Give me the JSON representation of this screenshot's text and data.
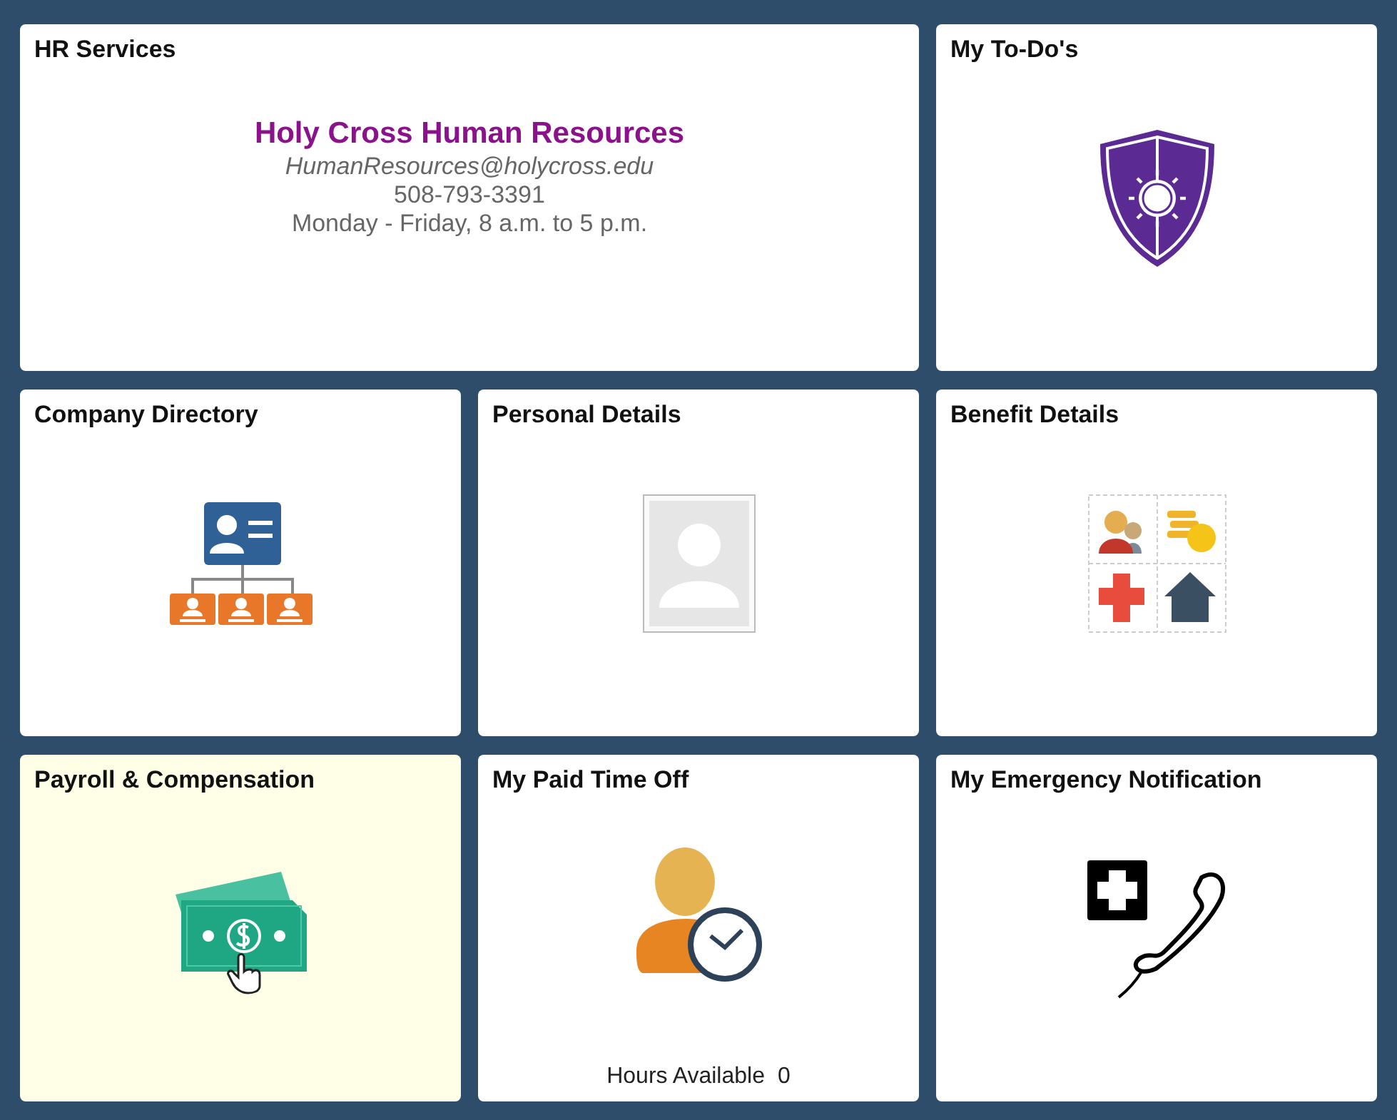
{
  "tiles": [
    {
      "title": "HR Services",
      "kind": "contact",
      "highlighted": false,
      "contact": {
        "name": "Holy Cross Human Resources",
        "email": "HumanResources@holycross.edu",
        "phone": "508-793-3391",
        "hours": "Monday - Friday, 8 a.m. to 5 p.m."
      }
    },
    {
      "title": "My To-Do's",
      "kind": "shield",
      "highlighted": false
    },
    {
      "title": "Company Directory",
      "kind": "orgchart",
      "highlighted": false
    },
    {
      "title": "Personal Details",
      "kind": "photo",
      "highlighted": false
    },
    {
      "title": "Benefit Details",
      "kind": "benefits",
      "highlighted": false
    },
    {
      "title": "Payroll & Compensation",
      "kind": "money",
      "highlighted": true
    },
    {
      "title": "My Paid Time Off",
      "kind": "timeoff",
      "highlighted": false,
      "footer": {
        "label": "Hours Available",
        "value": "0"
      }
    },
    {
      "title": "My Emergency Notification",
      "kind": "emergency",
      "highlighted": false
    }
  ]
}
